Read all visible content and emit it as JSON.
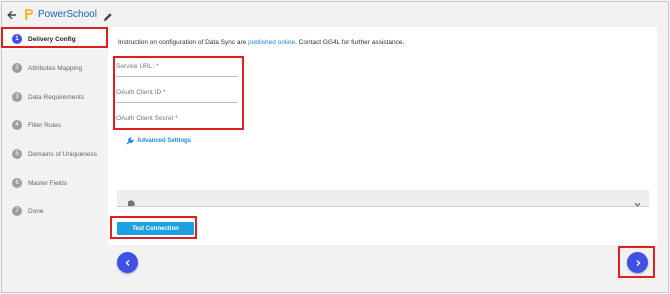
{
  "header": {
    "back_icon": "arrow-left-icon",
    "logo_icon": "powerschool-logo-icon",
    "title": "PowerSchool",
    "edit_icon": "pencil-icon"
  },
  "sidebar": {
    "steps": [
      {
        "number": "1",
        "label": "Delivery Config",
        "active": true
      },
      {
        "number": "2",
        "label": "Attributes Mapping",
        "active": false
      },
      {
        "number": "3",
        "label": "Data Requirements",
        "active": false
      },
      {
        "number": "4",
        "label": "Filter Rules",
        "active": false
      },
      {
        "number": "5",
        "label": "Domains of Uniqueness",
        "active": false
      },
      {
        "number": "6",
        "label": "Master Fields",
        "active": false
      },
      {
        "number": "7",
        "label": "Done",
        "active": false
      }
    ]
  },
  "main": {
    "instruction_prefix": "Instruction on configuration of Data Sync are ",
    "instruction_link": "published online",
    "instruction_suffix": ". Contact GG4L for further assistance.",
    "fields": {
      "service_url": "Service URL: *",
      "client_id": "OAuth Client ID *",
      "client_secret": "OAuth Client Secret *"
    },
    "advanced_settings": "Advanced Settings",
    "test_connection": "Test Connection"
  },
  "colors": {
    "accent": "#3f51e5",
    "link": "#1e88e5",
    "button": "#1da1e5",
    "highlight": "#e02020"
  }
}
